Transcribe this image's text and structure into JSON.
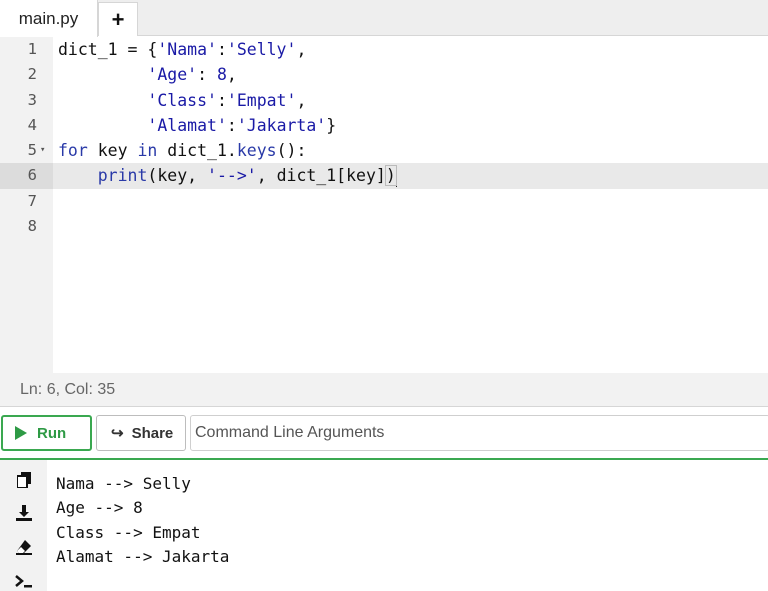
{
  "tabs": {
    "file_name": "main.py",
    "add_label": "+"
  },
  "editor": {
    "lines": [
      {
        "no": "1",
        "fold": "",
        "active": false,
        "segments": [
          [
            "dict_1 = {",
            ""
          ],
          [
            "'Nama'",
            "str"
          ],
          [
            ":",
            ""
          ],
          [
            "'Selly'",
            "str"
          ],
          [
            ",",
            ""
          ]
        ]
      },
      {
        "no": "2",
        "fold": "",
        "active": false,
        "segments": [
          [
            "         ",
            ""
          ],
          [
            "'Age'",
            "str"
          ],
          [
            ": ",
            ""
          ],
          [
            "8",
            "num"
          ],
          [
            ",",
            ""
          ]
        ]
      },
      {
        "no": "3",
        "fold": "",
        "active": false,
        "segments": [
          [
            "         ",
            ""
          ],
          [
            "'Class'",
            "str"
          ],
          [
            ":",
            ""
          ],
          [
            "'Empat'",
            "str"
          ],
          [
            ",",
            ""
          ]
        ]
      },
      {
        "no": "4",
        "fold": "",
        "active": false,
        "segments": [
          [
            "         ",
            ""
          ],
          [
            "'Alamat'",
            "str"
          ],
          [
            ":",
            ""
          ],
          [
            "'Jakarta'",
            "str"
          ],
          [
            "}",
            ""
          ]
        ]
      },
      {
        "no": "5",
        "fold": "▾",
        "active": false,
        "segments": [
          [
            "for",
            "kw"
          ],
          [
            " key ",
            ""
          ],
          [
            "in",
            "kw"
          ],
          [
            " dict_1.",
            ""
          ],
          [
            "keys",
            "call"
          ],
          [
            "():",
            ""
          ]
        ]
      },
      {
        "no": "6",
        "fold": "",
        "active": true,
        "segments": [
          [
            "    ",
            ""
          ],
          [
            "print",
            "call"
          ],
          [
            "(key, ",
            ""
          ],
          [
            "'-->'",
            "str"
          ],
          [
            ", dict_1[key]",
            ""
          ],
          [
            ")",
            "bracket"
          ]
        ]
      },
      {
        "no": "7",
        "fold": "",
        "active": false,
        "segments": []
      },
      {
        "no": "8",
        "fold": "",
        "active": false,
        "segments": []
      }
    ]
  },
  "status": {
    "position": "Ln: 6,  Col: 35"
  },
  "toolbar": {
    "run_label": "Run",
    "share_label": "Share",
    "args_placeholder": "Command Line Arguments"
  },
  "output": {
    "side_icons": [
      "copy-icon",
      "download-icon",
      "eraser-icon",
      "terminal-icon"
    ],
    "lines": [
      "Nama --> Selly",
      "Age --> 8",
      "Class --> Empat",
      "Alamat --> Jakarta"
    ]
  },
  "colors": {
    "accent": "#3aa850",
    "string": "#1a1aa6",
    "keyword": "#2a3aa8"
  }
}
